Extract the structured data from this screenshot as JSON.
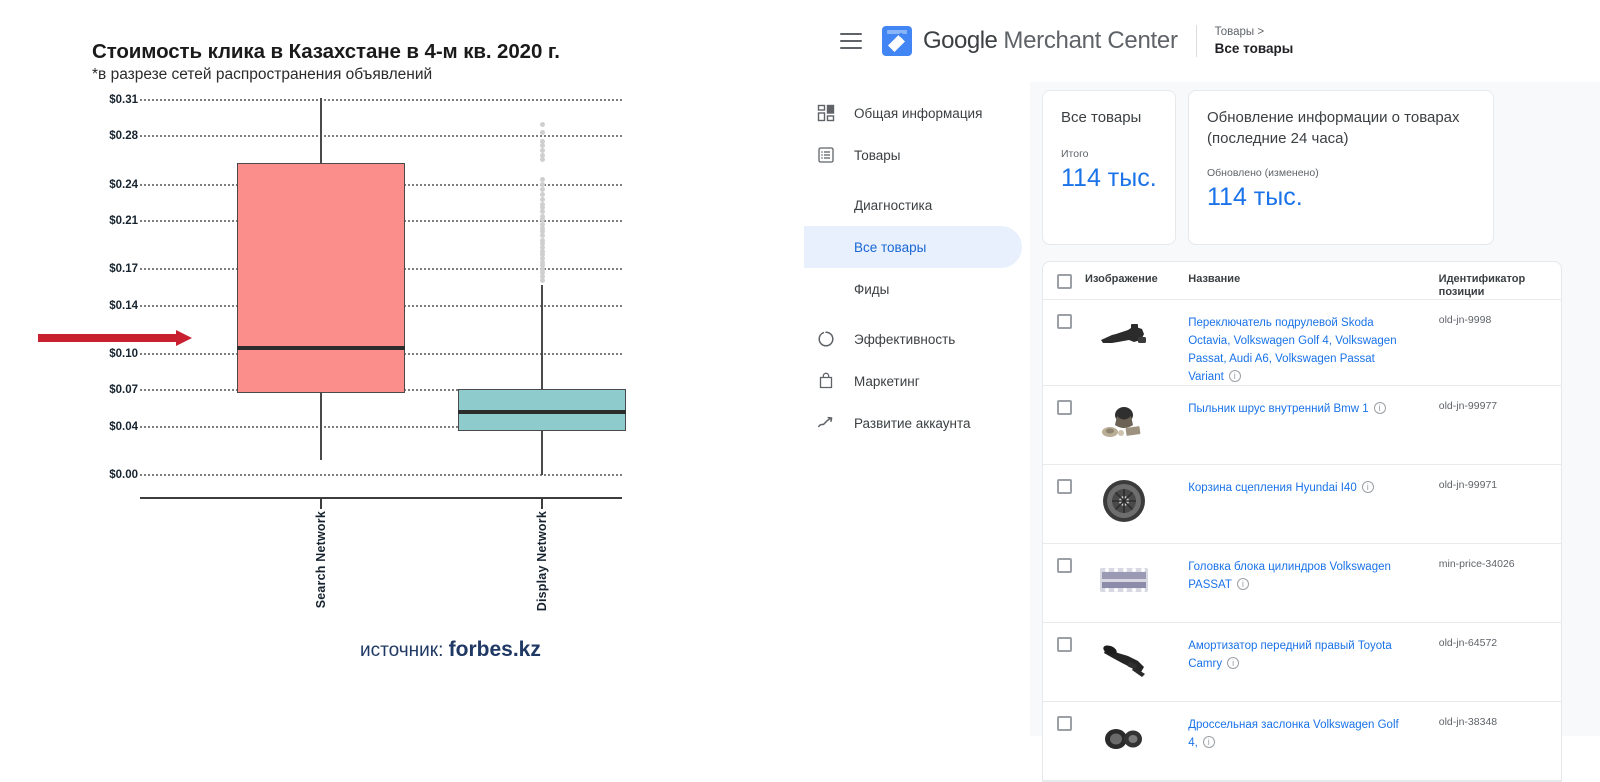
{
  "chart_data": {
    "type": "box",
    "title": "Стоимость клика в Казахстане в 4-м кв. 2020 г.",
    "subtitle": "*в разрезе сетей распространения объявлений",
    "categories": [
      "Search Network",
      "Display Network"
    ],
    "ylabel": "",
    "xlabel": "",
    "ylim": [
      0.0,
      0.31
    ],
    "grid": true,
    "ytick_labels": [
      "$0.31",
      "$0.28",
      "$0.24",
      "$0.21",
      "$0.17",
      "$0.14",
      "$0.10",
      "$0.07",
      "$0.04",
      "$0.00"
    ],
    "ytick_values": [
      0.31,
      0.28,
      0.24,
      0.21,
      0.17,
      0.14,
      0.1,
      0.07,
      0.04,
      0.0
    ],
    "series": [
      {
        "name": "Search Network",
        "color": "#fb8e8b",
        "whisker_low": 0.012,
        "q1": 0.068,
        "median": 0.105,
        "q3": 0.258,
        "whisker_high": 0.312,
        "outliers": []
      },
      {
        "name": "Display Network",
        "color": "#8ecbcd",
        "whisker_low": 0.0,
        "q1": 0.036,
        "median": 0.052,
        "q3": 0.071,
        "whisker_high": 0.157,
        "outliers": [
          0.29,
          0.283,
          0.276,
          0.272,
          0.268,
          0.264,
          0.261,
          0.244,
          0.24,
          0.236,
          0.232,
          0.228,
          0.224,
          0.221,
          0.218,
          0.214,
          0.211,
          0.207,
          0.204,
          0.201,
          0.198,
          0.194,
          0.191,
          0.188,
          0.185,
          0.182,
          0.179,
          0.176,
          0.173,
          0.17,
          0.167,
          0.164,
          0.161
        ]
      }
    ],
    "annotations": [
      {
        "type": "arrow",
        "color": "#c8202e",
        "points_to": "Search Network median",
        "value": 0.105
      }
    ],
    "source_prefix": "источник:",
    "source_name": "forbes.kz",
    "source_color": "#1f3864"
  },
  "gmc": {
    "header": {
      "menu_icon": "hamburger-icon",
      "logo_icon": "google-merchant-center-logo",
      "brand_google": "Google",
      "brand_product": "Merchant Center",
      "breadcrumb_parent": "Товары >",
      "breadcrumb_current": "Все товары"
    },
    "sidebar": {
      "items": [
        {
          "label": "Общая информация",
          "icon": "dashboard-icon",
          "level": "top",
          "active": false
        },
        {
          "label": "Товары",
          "icon": "products-list-icon",
          "level": "top",
          "active": false
        },
        {
          "label": "Диагностика",
          "icon": "",
          "level": "sub",
          "active": false
        },
        {
          "label": "Все товары",
          "icon": "",
          "level": "sub",
          "active": true
        },
        {
          "label": "Фиды",
          "icon": "",
          "level": "sub",
          "active": false
        },
        {
          "label": "Эффективность",
          "icon": "performance-donut-icon",
          "level": "top",
          "active": false
        },
        {
          "label": "Маркетинг",
          "icon": "marketing-bag-icon",
          "level": "top",
          "active": false
        },
        {
          "label": "Развитие аккаунта",
          "icon": "growth-trend-icon",
          "level": "top",
          "active": false
        }
      ],
      "active_color": "#1967d2",
      "active_bg": "#e8f0fe"
    },
    "cards": [
      {
        "title": "Все товары",
        "sub": "Итого",
        "value": "114 тыс."
      },
      {
        "title": "Обновление информации о товарах (последние 24 часа)",
        "sub": "Обновлено (изменено)",
        "value": "114 тыс."
      }
    ],
    "table": {
      "columns": {
        "image": "Изображение",
        "name": "Название",
        "id": "Идентификатор позиции"
      },
      "rows": [
        {
          "name": "Переключатель подрулевой Skoda Octavia, Volkswagen Golf 4, Volkswagen Passat, Audi A6, Volkswagen Passat Variant",
          "id": "old-jn-9998",
          "thumb": "steering-column-switch-thumbnail"
        },
        {
          "name": "Пыльник шрус внутренний Bmw 1",
          "id": "old-jn-99977",
          "thumb": "cv-joint-boot-kit-thumbnail"
        },
        {
          "name": "Корзина сцепления Hyundai I40",
          "id": "old-jn-99971",
          "thumb": "clutch-pressure-plate-thumbnail"
        },
        {
          "name": "Головка блока цилиндров Volkswagen PASSAT",
          "id": "min-price-34026",
          "thumb": "cylinder-head-thumbnail"
        },
        {
          "name": "Амортизатор передний правый Toyota Camry",
          "id": "old-jn-64572",
          "thumb": "shock-absorber-thumbnail"
        },
        {
          "name": "Дроссельная заслонка Volkswagen Golf 4,",
          "id": "old-jn-38348",
          "thumb": "throttle-body-thumbnail"
        }
      ]
    }
  }
}
